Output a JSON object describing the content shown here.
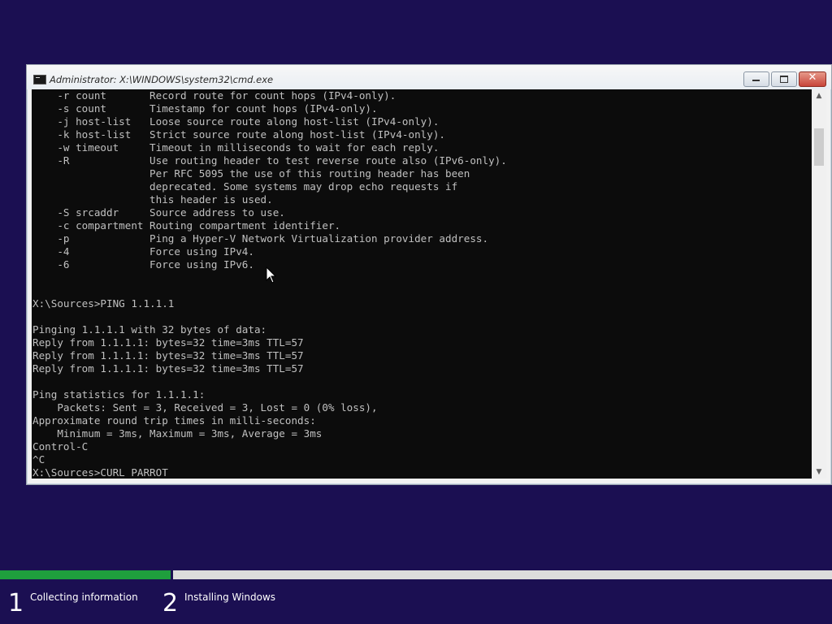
{
  "window": {
    "title": "Administrator: X:\\WINDOWS\\system32\\cmd.exe",
    "minimize_icon": "minimize-icon",
    "maximize_icon": "maximize-icon",
    "close_icon": "close-icon",
    "close_glyph": "✕"
  },
  "console": {
    "lines": [
      "    -r count       Record route for count hops (IPv4-only).",
      "    -s count       Timestamp for count hops (IPv4-only).",
      "    -j host-list   Loose source route along host-list (IPv4-only).",
      "    -k host-list   Strict source route along host-list (IPv4-only).",
      "    -w timeout     Timeout in milliseconds to wait for each reply.",
      "    -R             Use routing header to test reverse route also (IPv6-only).",
      "                   Per RFC 5095 the use of this routing header has been",
      "                   deprecated. Some systems may drop echo requests if",
      "                   this header is used.",
      "    -S srcaddr     Source address to use.",
      "    -c compartment Routing compartment identifier.",
      "    -p             Ping a Hyper-V Network Virtualization provider address.",
      "    -4             Force using IPv4.",
      "    -6             Force using IPv6.",
      "",
      "",
      "X:\\Sources>PING 1.1.1.1",
      "",
      "Pinging 1.1.1.1 with 32 bytes of data:",
      "Reply from 1.1.1.1: bytes=32 time=3ms TTL=57",
      "Reply from 1.1.1.1: bytes=32 time=3ms TTL=57",
      "Reply from 1.1.1.1: bytes=32 time=3ms TTL=57",
      "",
      "Ping statistics for 1.1.1.1:",
      "    Packets: Sent = 3, Received = 3, Lost = 0 (0% loss),",
      "Approximate round trip times in milli-seconds:",
      "    Minimum = 3ms, Maximum = 3ms, Average = 3ms",
      "Control-C",
      "^C",
      "X:\\Sources>CURL PARROT"
    ]
  },
  "scrollbar": {
    "up_arrow": "▲",
    "down_arrow": "▼"
  },
  "setup": {
    "progress_fraction": 0.205,
    "steps": [
      {
        "number": "1",
        "label": "Collecting information"
      },
      {
        "number": "2",
        "label": "Installing Windows"
      }
    ]
  },
  "colors": {
    "background": "#1b0f52",
    "progress_fill": "#1f9f3d",
    "progress_track": "#dcdcdc",
    "console_bg": "#0c0c0c",
    "console_text": "#c0c0c0"
  }
}
